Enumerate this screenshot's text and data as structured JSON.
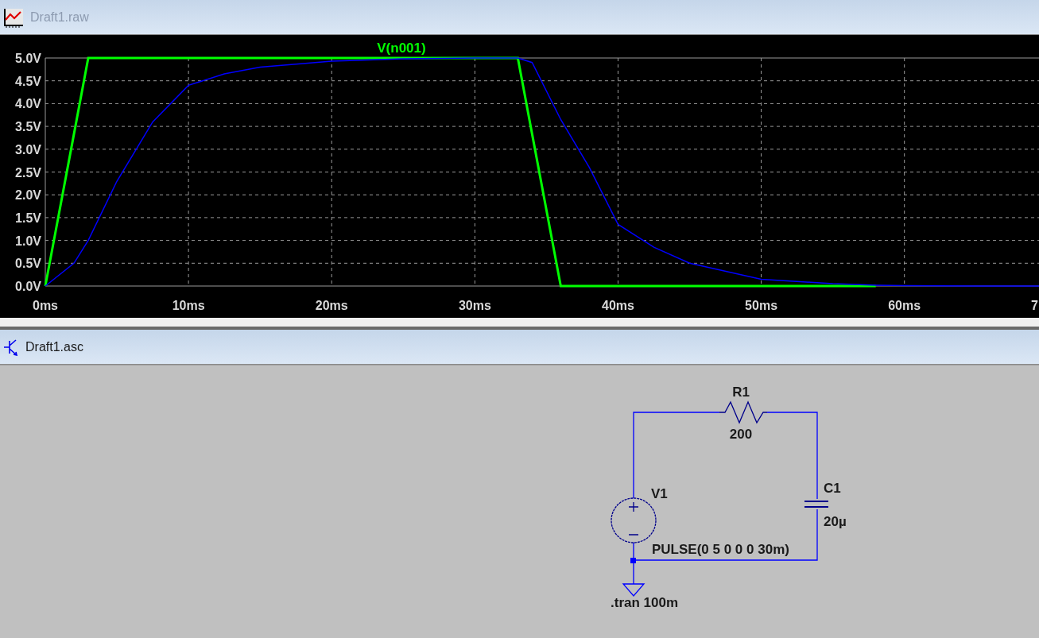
{
  "plot_window": {
    "title": "Draft1.raw",
    "active": false,
    "edge_axis_label": "7",
    "chart_data": {
      "type": "line",
      "x": [
        0,
        2,
        3,
        5,
        7.5,
        10,
        12.5,
        15,
        20,
        25,
        30,
        33,
        34,
        36,
        38,
        40,
        42.5,
        45,
        50,
        55,
        58,
        60,
        65,
        69.4
      ],
      "series": [
        {
          "name": "V(n001)",
          "color": "#00ff00",
          "values": [
            0,
            3.33,
            5,
            5,
            5,
            5,
            5,
            5,
            5,
            5,
            5,
            5,
            3.33,
            0,
            0,
            0,
            0,
            0,
            0,
            0,
            0,
            null,
            null,
            null
          ]
        },
        {
          "color": "#0000ff",
          "values": [
            0,
            0.5,
            1.0,
            2.3,
            3.6,
            4.4,
            4.65,
            4.8,
            4.93,
            4.98,
            5,
            5,
            4.9,
            3.65,
            2.6,
            1.35,
            0.85,
            0.5,
            0.15,
            0.05,
            0.02,
            0.01,
            0,
            0
          ]
        }
      ],
      "xticks": [
        {
          "value": 0,
          "label": "0ms"
        },
        {
          "value": 10,
          "label": "10ms"
        },
        {
          "value": 20,
          "label": "20ms"
        },
        {
          "value": 30,
          "label": "30ms"
        },
        {
          "value": 40,
          "label": "40ms"
        },
        {
          "value": 50,
          "label": "50ms"
        },
        {
          "value": 60,
          "label": "60ms"
        }
      ],
      "yticks": [
        {
          "value": 0,
          "label": "0.0V"
        },
        {
          "value": 0.5,
          "label": "0.5V"
        },
        {
          "value": 1,
          "label": "1.0V"
        },
        {
          "value": 1.5,
          "label": "1.5V"
        },
        {
          "value": 2,
          "label": "2.0V"
        },
        {
          "value": 2.5,
          "label": "2.5V"
        },
        {
          "value": 3,
          "label": "3.0V"
        },
        {
          "value": 3.5,
          "label": "3.5V"
        },
        {
          "value": 4,
          "label": "4.0V"
        },
        {
          "value": 4.5,
          "label": "4.5V"
        },
        {
          "value": 5,
          "label": "5.0V"
        }
      ],
      "xlim": [
        0,
        69.4
      ],
      "ylim": [
        0,
        5
      ],
      "grid": true
    }
  },
  "schematic_window": {
    "title": "Draft1.asc",
    "active": true,
    "components": [
      {
        "kind": "resistor",
        "name": "R1",
        "value": "200"
      },
      {
        "kind": "capacitor",
        "name": "C1",
        "value": "20µ"
      },
      {
        "kind": "voltage_source",
        "name": "V1",
        "value": "PULSE(0 5 0 0 0 30m)"
      }
    ],
    "directive": ".tran 100m"
  }
}
